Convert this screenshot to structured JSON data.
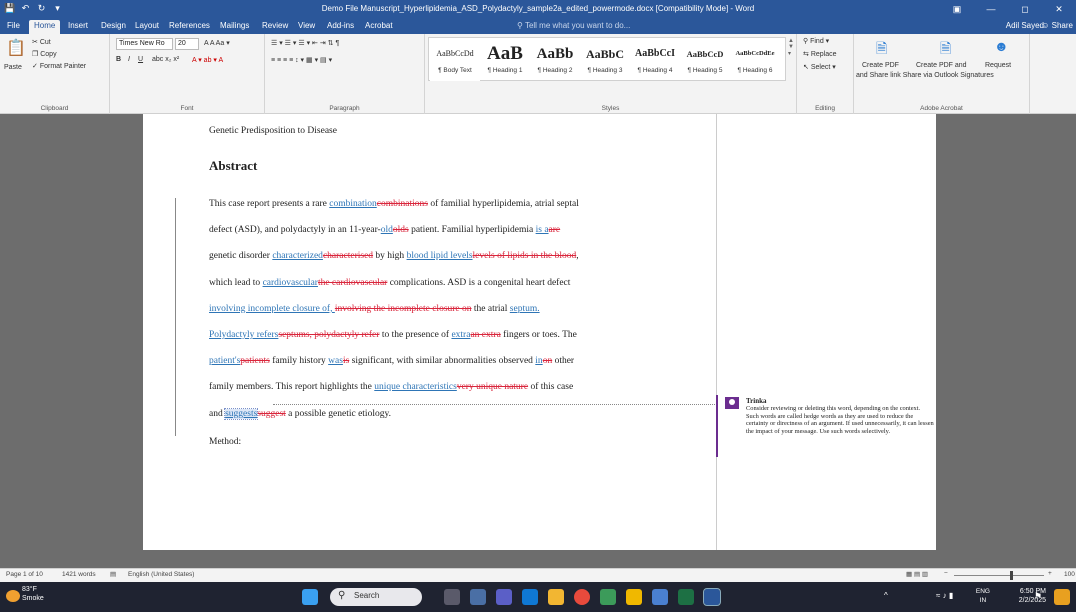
{
  "titlebar": {
    "doc_title": "Demo File Manuscript_Hyperlipidemia_ASD_Polydactyly_sample2a_edited_powermode.docx [Compatibility Mode] - Word"
  },
  "tabs": [
    "File",
    "Home",
    "Insert",
    "Design",
    "Layout",
    "References",
    "Mailings",
    "Review",
    "View",
    "Add-ins",
    "Acrobat"
  ],
  "tell_me": "Tell me what you want to do...",
  "user_name": "Adil Sayed",
  "share_label": "Share",
  "clipboard": {
    "paste": "Paste",
    "cut": "Cut",
    "copy": "Copy",
    "format_painter": "Format Painter",
    "label": "Clipboard"
  },
  "font": {
    "name": "Times New Ro",
    "size": "20",
    "label": "Font"
  },
  "paragraph": {
    "label": "Paragraph"
  },
  "styles": {
    "label": "Styles",
    "items": [
      {
        "preview": "AaBbCcDd",
        "name": "¶ Body Text"
      },
      {
        "preview": "AaB",
        "name": "¶ Heading 1"
      },
      {
        "preview": "AaBb",
        "name": "¶ Heading 2"
      },
      {
        "preview": "AaBbC",
        "name": "¶ Heading 3"
      },
      {
        "preview": "AaBbCcI",
        "name": "¶ Heading 4"
      },
      {
        "preview": "AaBbCcD",
        "name": "¶ Heading 5"
      },
      {
        "preview": "AaBbCcDdEe",
        "name": "¶ Heading 6"
      }
    ]
  },
  "editing": {
    "find": "Find",
    "replace": "Replace",
    "select": "Select",
    "label": "Editing"
  },
  "acrobat": {
    "create_pdf": "Create PDF",
    "create_pdf_share": "Create PDF and",
    "request": "Request",
    "line2": "and Share link Share via Outlook Signatures",
    "label": "Adobe Acrobat"
  },
  "document": {
    "section_title": "Genetic Predisposition to Disease",
    "abstract_heading": "Abstract",
    "method_label": "Method:",
    "lines": [
      [
        {
          "t": "This case report presents a rare ",
          "k": "n"
        },
        {
          "t": "combination",
          "k": "i"
        },
        {
          "t": "combinations",
          "k": "d"
        },
        {
          "t": " of familial hyperlipidemia, atrial septal",
          "k": "n"
        }
      ],
      [
        {
          "t": "defect (ASD), and polydactyly in an 11-year-",
          "k": "n"
        },
        {
          "t": "old",
          "k": "i"
        },
        {
          "t": "olds",
          "k": "d"
        },
        {
          "t": " patient. Familial hyperlipidemia ",
          "k": "n"
        },
        {
          "t": "is a",
          "k": "i"
        },
        {
          "t": "are",
          "k": "d"
        }
      ],
      [
        {
          "t": "genetic disorder ",
          "k": "n"
        },
        {
          "t": "characterized",
          "k": "i"
        },
        {
          "t": "characterised",
          "k": "d"
        },
        {
          "t": " by high ",
          "k": "n"
        },
        {
          "t": "blood lipid levels",
          "k": "i"
        },
        {
          "t": "levels of lipids in the blood",
          "k": "d"
        },
        {
          "t": ",",
          "k": "n"
        }
      ],
      [
        {
          "t": "which lead to ",
          "k": "n"
        },
        {
          "t": "cardiovascular",
          "k": "i"
        },
        {
          "t": "the cardiovascular",
          "k": "d"
        },
        {
          "t": " complications. ASD is a congenital heart defect",
          "k": "n"
        }
      ],
      [
        {
          "t": "involving incomplete closure of, ",
          "k": "i"
        },
        {
          "t": "involving the incomplete closure on",
          "k": "d"
        },
        {
          "t": " the atrial ",
          "k": "n"
        },
        {
          "t": "septum.",
          "k": "i"
        }
      ],
      [
        {
          "t": "Polydactyly refers",
          "k": "i"
        },
        {
          "t": "septums, polydactyly refer",
          "k": "d"
        },
        {
          "t": " to the presence of ",
          "k": "n"
        },
        {
          "t": "extra",
          "k": "i"
        },
        {
          "t": "an extra",
          "k": "d"
        },
        {
          "t": " fingers or toes. The",
          "k": "n"
        }
      ],
      [
        {
          "t": "patient's",
          "k": "i"
        },
        {
          "t": "patients",
          "k": "d"
        },
        {
          "t": " family history ",
          "k": "n"
        },
        {
          "t": "was",
          "k": "i"
        },
        {
          "t": "is",
          "k": "d"
        },
        {
          "t": " significant, with similar abnormalities observed ",
          "k": "n"
        },
        {
          "t": "in",
          "k": "i"
        },
        {
          "t": "on",
          "k": "d"
        },
        {
          "t": " other",
          "k": "n"
        }
      ],
      [
        {
          "t": "family members. This report highlights the ",
          "k": "n"
        },
        {
          "t": "unique characteristics",
          "k": "i"
        },
        {
          "t": "very unique nature",
          "k": "d"
        },
        {
          "t": " of this case",
          "k": "n"
        }
      ],
      [
        {
          "t": "and ",
          "k": "n"
        },
        {
          "t": "suggests",
          "k": "h"
        },
        {
          "t": "suggest",
          "k": "d"
        },
        {
          "t": " a possible genetic etiology.",
          "k": "n"
        }
      ]
    ]
  },
  "comment": {
    "author": "Trinka",
    "text": "Consider reviewing or deleting this word, depending on the context. Such words are called hedge words as they are used to reduce the certainty or directness of an argument. If used unnecessarily, it can lessen the impact of your message. Use such words selectively."
  },
  "statusbar": {
    "page": "Page 1 of 10",
    "words": "1421 words",
    "language": "English (United States)",
    "zoom": "100"
  },
  "taskbar": {
    "temp": "83°F",
    "weather": "Smoke",
    "search": "Search",
    "lang1": "ENG",
    "lang2": "IN",
    "time": "6:50 PM",
    "date": "2/2/2025"
  },
  "colors": {
    "word_blue": "#2b579a",
    "insert": "#2e75b6",
    "delete": "#d9263c",
    "comment_accent": "#6b2d8f"
  }
}
